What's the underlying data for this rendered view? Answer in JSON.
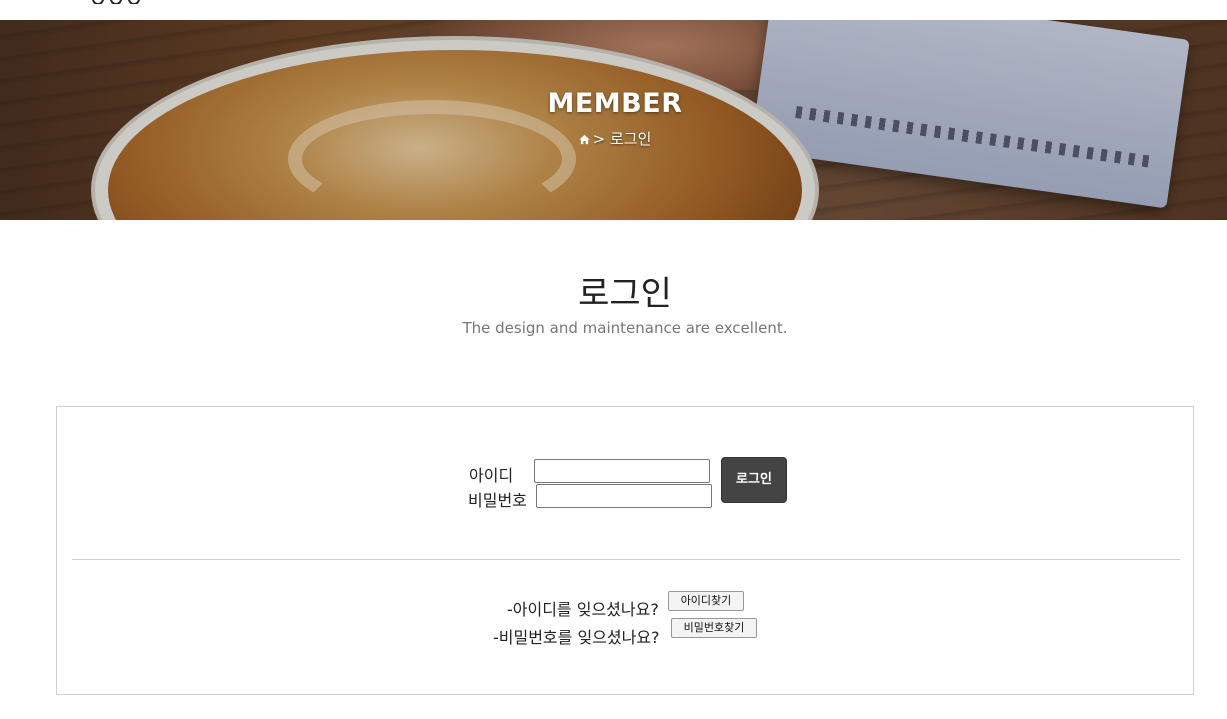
{
  "hero": {
    "title": "MEMBER",
    "breadcrumb_separator": ">",
    "breadcrumb_current": "로그인"
  },
  "section": {
    "title": "로그인",
    "subtitle": "The design and maintenance are excellent."
  },
  "login_form": {
    "id_label": "아이디",
    "id_value": "",
    "password_label": "비밀번호",
    "password_value": "",
    "submit_label": "로그인"
  },
  "recovery": {
    "forgot_id_text": "-아이디를 잊으셨나요?",
    "find_id_label": "아이디찾기",
    "forgot_pw_text": "-비밀번호를 잊으셨나요?",
    "find_pw_label": "비밀번호찾기"
  },
  "icons": {
    "breadcrumb_home": "home-icon"
  }
}
